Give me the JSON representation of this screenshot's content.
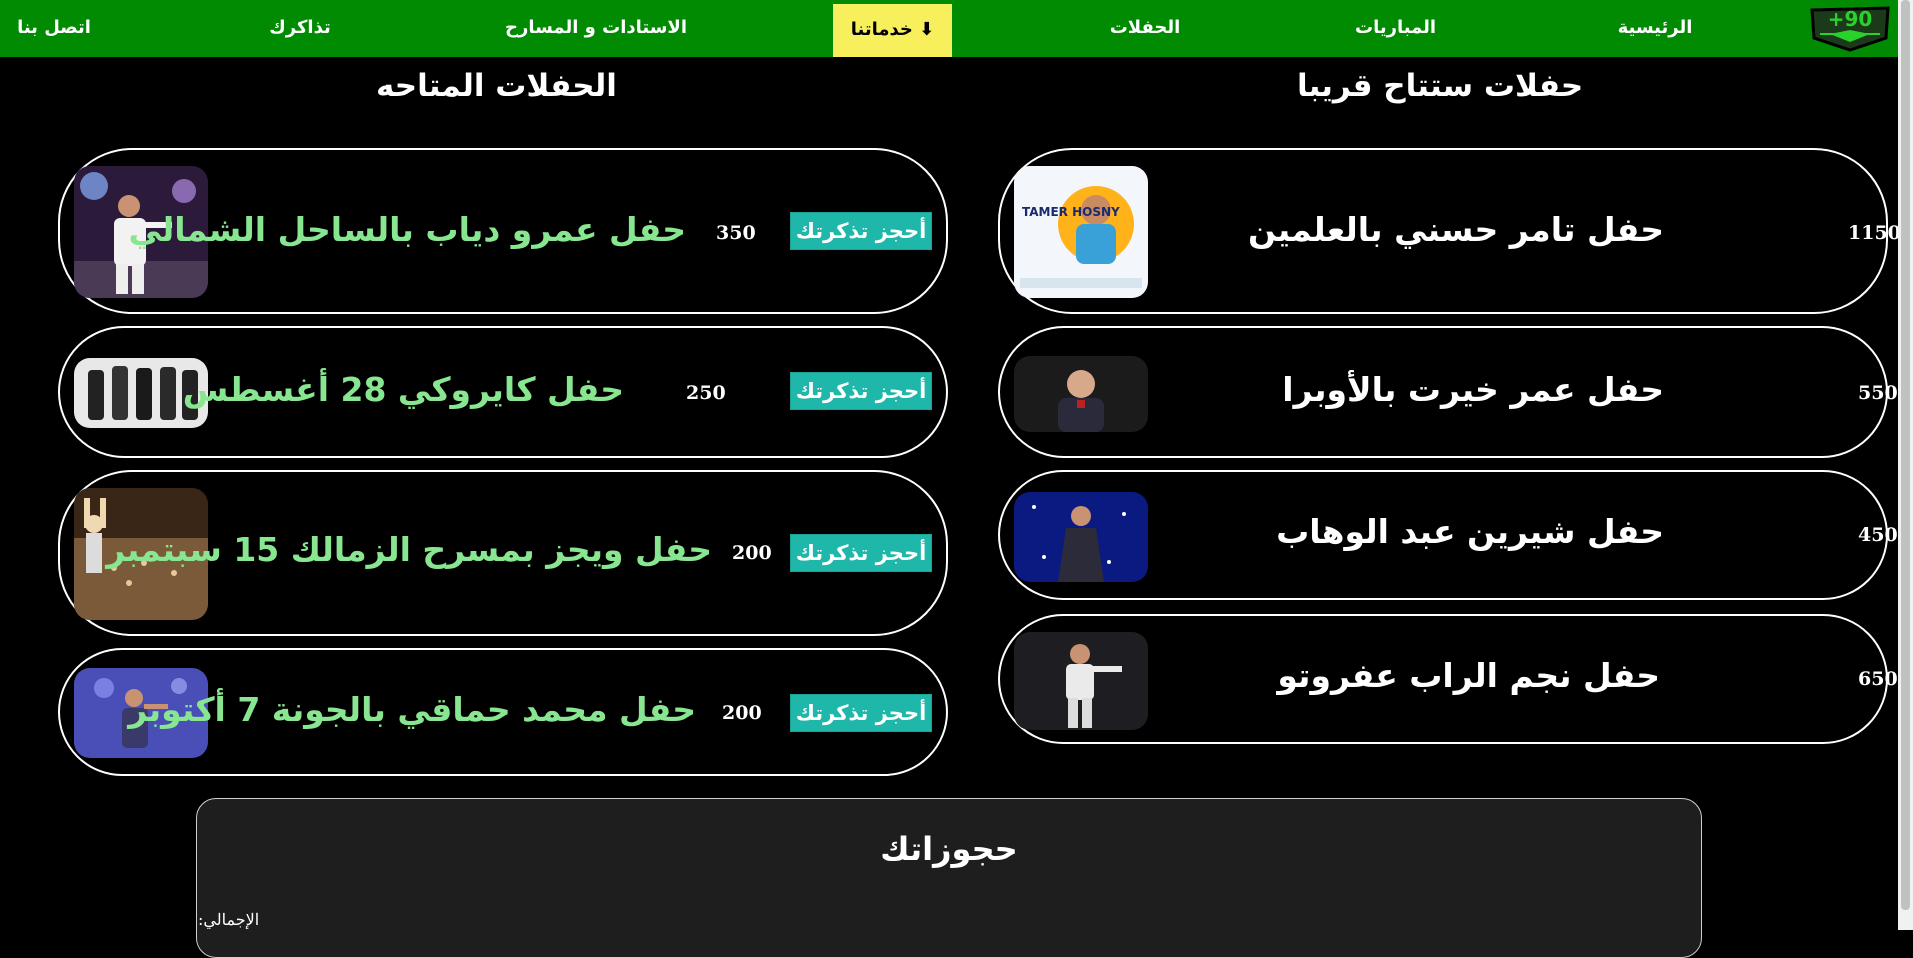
{
  "nav": {
    "home": "الرئيسية",
    "matches": "المباريات",
    "concerts": "الحفلات",
    "services": "خدماتنا ⬇",
    "venues": "الاستادات و المسارح",
    "tickets": "تذاكرك",
    "contact": "اتصل بنا",
    "logo_text": "+90"
  },
  "sections": {
    "available_title": "الحفلات المتاحه",
    "coming_title": "حفلات ستتاح قريبا"
  },
  "available_concerts": [
    {
      "title": "حفل عمرو دياب بالساحل الشمالي",
      "price": "350",
      "button": "أحجز تذكرتك",
      "image": "amr-diab-photo"
    },
    {
      "title": "حفل كايروكي 28 أغسطس",
      "price": "250",
      "button": "أحجز تذكرتك",
      "image": "cairokee-photo"
    },
    {
      "title": "حفل ويجز بمسرح الزمالك 15 سبتمبر",
      "price": "200",
      "button": "أحجز تذكرتك",
      "image": "wegz-photo"
    },
    {
      "title": "حفل محمد حماقي بالجونة 7 أكتوبر",
      "price": "200",
      "button": "أحجز تذكرتك",
      "image": "hamaki-photo"
    }
  ],
  "coming_concerts": [
    {
      "title": "حفل تامر حسني بالعلمين",
      "price": "1150",
      "image": "tamer-hosny-poster",
      "poster_text": "TAMER HOSNY"
    },
    {
      "title": "حفل عمر خيرت بالأوبرا",
      "price": "550",
      "image": "omar-khairat-photo"
    },
    {
      "title": "حفل شيرين عبد الوهاب",
      "price": "450",
      "image": "sherine-photo"
    },
    {
      "title": "حفل نجم الراب عفروتو",
      "price": "650",
      "image": "afroto-photo"
    }
  ],
  "bookings": {
    "title": "حجوزاتك",
    "total_label": "الإجمالي:"
  },
  "colors": {
    "nav_bg": "#018b02",
    "active_tab": "#f7ef5b",
    "button_bg": "#1fb7aa",
    "available_title_color": "#88e691"
  }
}
